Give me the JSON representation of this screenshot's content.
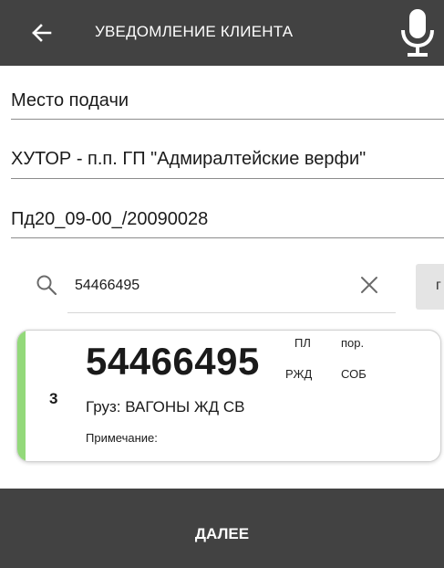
{
  "header": {
    "title": "УВЕДОМЛЕНИЕ КЛИЕНТА",
    "back_icon": "arrow-left-icon",
    "mic_icon": "microphone-icon",
    "background_color": "#424242"
  },
  "form": {
    "place_label": "Место подачи",
    "address": "ХУТОР - п.п. ГП \"Адмиралтейские верфи\"",
    "document_code": "Пд20_09-00_/20090028"
  },
  "search": {
    "value": "54466495",
    "search_icon": "search-icon",
    "clear_icon": "close-icon",
    "side_button_label": "г"
  },
  "card": {
    "sequence": "3",
    "wagon_number": "54466495",
    "tags": {
      "pl": "ПЛ",
      "por": "пор.",
      "rzhd": "РЖД",
      "sob": "СОБ"
    },
    "cargo": "Груз: ВАГОНЫ ЖД СВ",
    "note": "Примечание:",
    "accent_color": "#93d97a"
  },
  "footer": {
    "next_label": "ДАЛЕЕ"
  }
}
